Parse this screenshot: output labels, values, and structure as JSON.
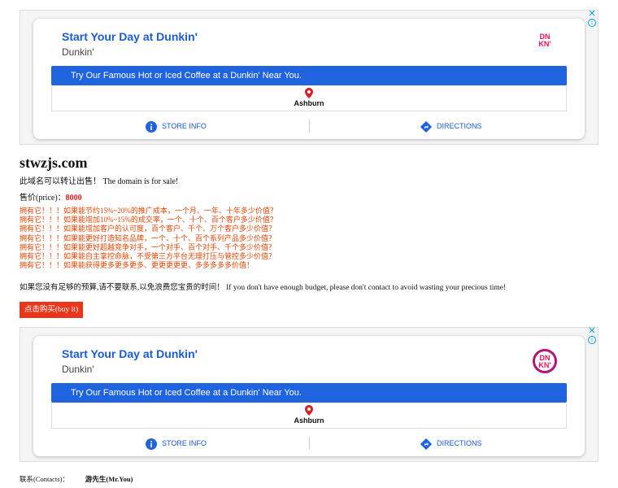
{
  "ad": {
    "close_glyph": "✕",
    "info_glyph": "i",
    "title": "Start Your Day at Dunkin'",
    "subtitle": "Dunkin'",
    "logo_text": "DN KN'",
    "banner": "Try Our Famous Hot or Iced Coffee at a Dunkin' Near You.",
    "city": "Ashburn",
    "store_info": "STORE INFO",
    "directions": "DIRECTIONS",
    "brand_color": "#1f64de",
    "logo_color": "#e8115b"
  },
  "page": {
    "domain": "stwzjs.com",
    "for_sale": "此域名可以转让出售！ The domain is for sale!",
    "price_label": "售价(price)：",
    "price_value": "8000",
    "pitch": [
      "拥有它！！！如果能节约15%~20%的推广成本，一个月、一年、十年多少价值？",
      "拥有它！！！如果能增加10%~15%的成交率，一个、十个、百个客户多少价值？",
      "拥有它！！！如果能增加客户的认可度，百个客户、千个、万个客户多少价值？",
      "拥有它！！！如果能更好打造知名品牌，一个、十个、百个系列产品多少价值？",
      "拥有它！！！如果能更好超越竞争对手，一个对手、百个对手、千个多少价值？",
      "拥有它！！！如果能自主掌控命脉，不受第三方平台无理打压与管控多少价值？",
      "拥有它！！！如果能获得更多更多更多、更更更更更、多多多多多价值！"
    ],
    "budget_note": "如果您没有足够的预算,请不要联系,以免浪费您宝贵的时间！ If you don't have enough budget, please don't contact to avoid wasting your precious time!",
    "buy_button": "点击购买(buy it)",
    "contact_label": "联系(Contacts)：",
    "contact_value": "游先生(Mr.You)"
  }
}
